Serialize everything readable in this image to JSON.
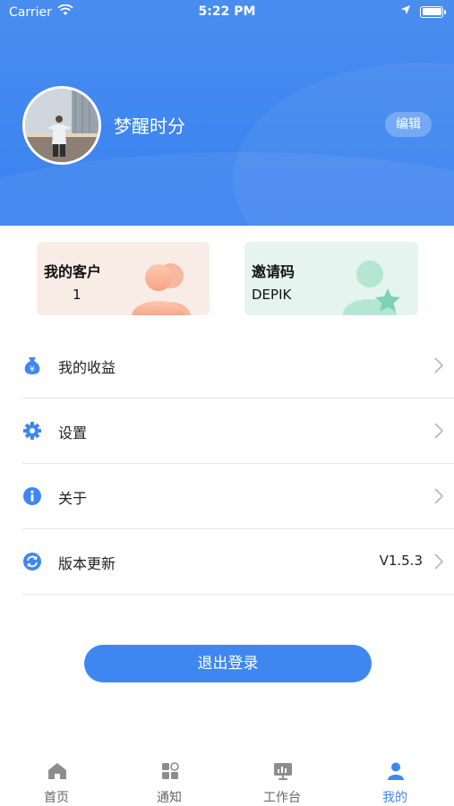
{
  "status_bar": {
    "carrier": "Carrier",
    "time": "5:22 PM"
  },
  "profile": {
    "username": "梦醒时分",
    "edit_label": "编辑"
  },
  "cards": {
    "customers": {
      "title": "我的客户",
      "value": "1"
    },
    "invite": {
      "title": "邀请码",
      "value": "DEPIK"
    }
  },
  "menu": {
    "items": [
      {
        "label": "我的收益",
        "icon": "money-bag-icon"
      },
      {
        "label": "设置",
        "icon": "gear-icon"
      },
      {
        "label": "关于",
        "icon": "info-icon"
      },
      {
        "label": "版本更新",
        "icon": "refresh-icon",
        "value": "V1.5.3"
      }
    ]
  },
  "logout_label": "退出登录",
  "tabbar": {
    "items": [
      {
        "label": "首页",
        "icon": "home-icon"
      },
      {
        "label": "通知",
        "icon": "grid-icon"
      },
      {
        "label": "工作台",
        "icon": "dashboard-icon"
      },
      {
        "label": "我的",
        "icon": "user-icon",
        "active": true
      }
    ]
  },
  "colors": {
    "primary": "#3f87f0",
    "customer_card_bg": "#f9ece6",
    "invite_card_bg": "#e5f4ef"
  }
}
